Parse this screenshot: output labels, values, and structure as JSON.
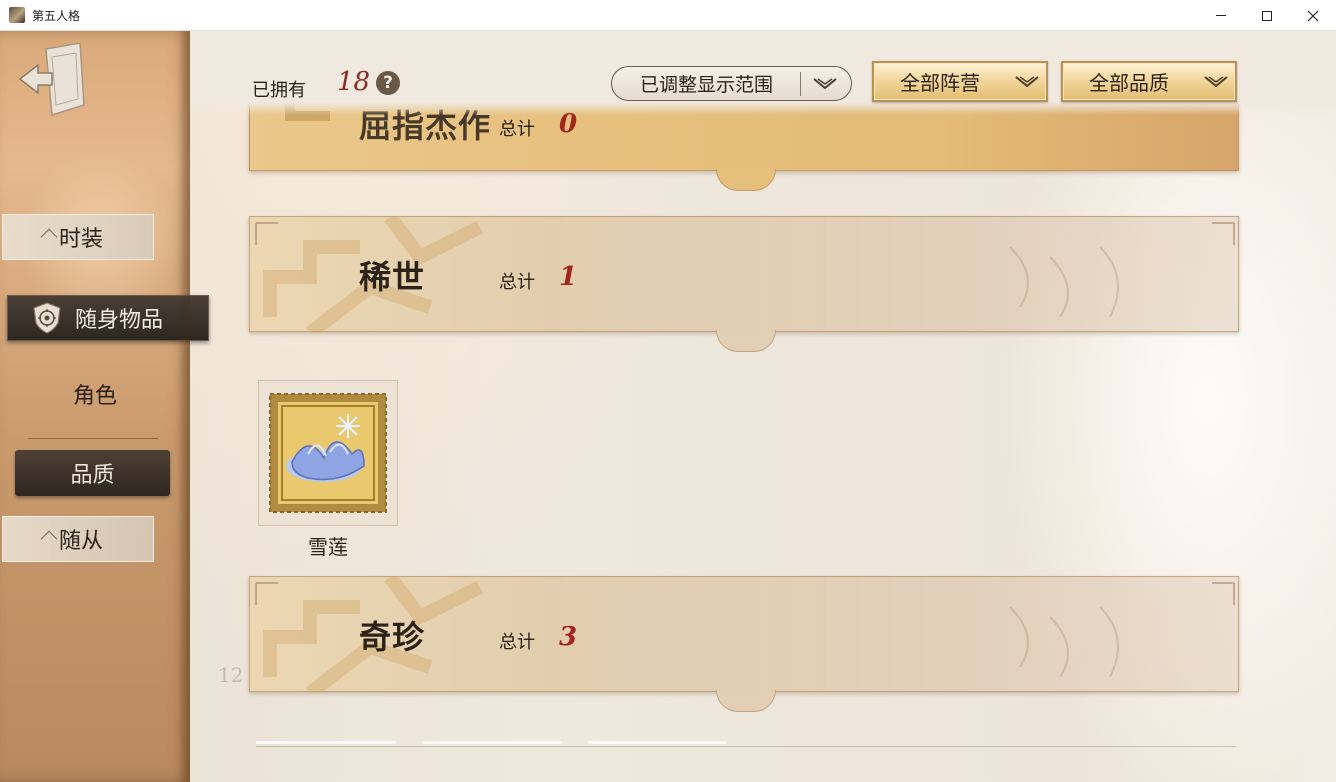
{
  "window": {
    "title": "第五人格"
  },
  "sidebar": {
    "tabs": [
      {
        "label": "时装"
      },
      {
        "label": "随身物品"
      },
      {
        "label": "随从"
      }
    ],
    "sub_tabs": [
      {
        "label": "角色"
      },
      {
        "label": "品质"
      }
    ]
  },
  "header": {
    "owned_label": "已拥有",
    "owned_count": "18",
    "help": "?",
    "range_filter": "已调整显示范围",
    "faction_filter": "全部阵营",
    "quality_filter": "全部品质"
  },
  "categories": [
    {
      "name": "屈指杰作",
      "total_label": "总计",
      "total": "0"
    },
    {
      "name": "稀世",
      "total_label": "总计",
      "total": "1"
    },
    {
      "name": "奇珍",
      "total_label": "总计",
      "total": "3"
    }
  ],
  "items": [
    {
      "name": "雪莲"
    }
  ],
  "page_number": "12",
  "colors": {
    "accent_red": "#a1271d",
    "dark_tab": "#2e2620",
    "gold_button": "#f3d79d"
  }
}
